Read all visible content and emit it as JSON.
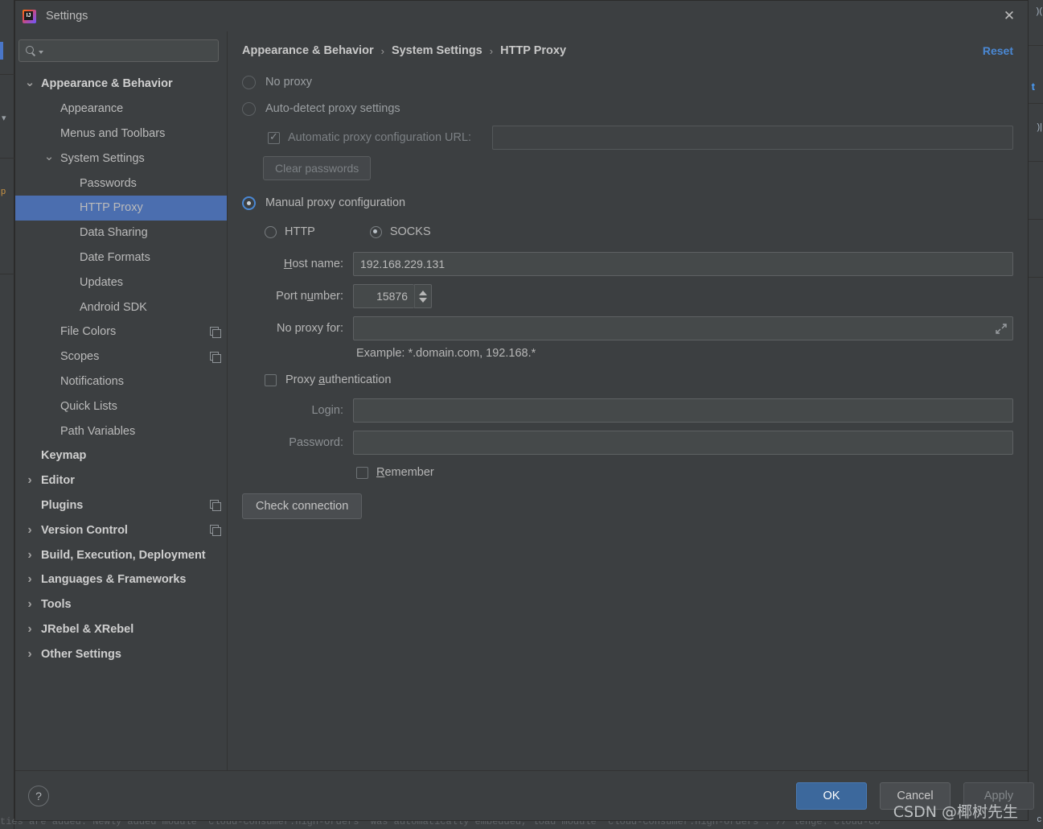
{
  "window": {
    "title": "Settings",
    "logo_icon": "intellij-idea-logo",
    "close_icon": "close-icon"
  },
  "sidebar": {
    "search": {
      "placeholder": "",
      "value": "",
      "icon": "search-icon",
      "caret_icon": "chevron-down-icon"
    },
    "items": [
      {
        "label": "Appearance & Behavior",
        "indent": 0,
        "arrow": "expanded",
        "bold": true,
        "selected": false,
        "copy_icon": false
      },
      {
        "label": "Appearance",
        "indent": 1,
        "arrow": "none",
        "bold": false,
        "selected": false,
        "copy_icon": false
      },
      {
        "label": "Menus and Toolbars",
        "indent": 1,
        "arrow": "none",
        "bold": false,
        "selected": false,
        "copy_icon": false
      },
      {
        "label": "System Settings",
        "indent": 1,
        "arrow": "expanded",
        "bold": false,
        "selected": false,
        "copy_icon": false
      },
      {
        "label": "Passwords",
        "indent": 2,
        "arrow": "none",
        "bold": false,
        "selected": false,
        "copy_icon": false
      },
      {
        "label": "HTTP Proxy",
        "indent": 2,
        "arrow": "none",
        "bold": false,
        "selected": true,
        "copy_icon": false
      },
      {
        "label": "Data Sharing",
        "indent": 2,
        "arrow": "none",
        "bold": false,
        "selected": false,
        "copy_icon": false
      },
      {
        "label": "Date Formats",
        "indent": 2,
        "arrow": "none",
        "bold": false,
        "selected": false,
        "copy_icon": false
      },
      {
        "label": "Updates",
        "indent": 2,
        "arrow": "none",
        "bold": false,
        "selected": false,
        "copy_icon": false
      },
      {
        "label": "Android SDK",
        "indent": 2,
        "arrow": "none",
        "bold": false,
        "selected": false,
        "copy_icon": false
      },
      {
        "label": "File Colors",
        "indent": 1,
        "arrow": "none",
        "bold": false,
        "selected": false,
        "copy_icon": true
      },
      {
        "label": "Scopes",
        "indent": 1,
        "arrow": "none",
        "bold": false,
        "selected": false,
        "copy_icon": true
      },
      {
        "label": "Notifications",
        "indent": 1,
        "arrow": "none",
        "bold": false,
        "selected": false,
        "copy_icon": false
      },
      {
        "label": "Quick Lists",
        "indent": 1,
        "arrow": "none",
        "bold": false,
        "selected": false,
        "copy_icon": false
      },
      {
        "label": "Path Variables",
        "indent": 1,
        "arrow": "none",
        "bold": false,
        "selected": false,
        "copy_icon": false
      },
      {
        "label": "Keymap",
        "indent": 0,
        "arrow": "none",
        "bold": true,
        "selected": false,
        "copy_icon": false
      },
      {
        "label": "Editor",
        "indent": 0,
        "arrow": "collapsed",
        "bold": true,
        "selected": false,
        "copy_icon": false
      },
      {
        "label": "Plugins",
        "indent": 0,
        "arrow": "none",
        "bold": true,
        "selected": false,
        "copy_icon": true
      },
      {
        "label": "Version Control",
        "indent": 0,
        "arrow": "collapsed",
        "bold": true,
        "selected": false,
        "copy_icon": true
      },
      {
        "label": "Build, Execution, Deployment",
        "indent": 0,
        "arrow": "collapsed",
        "bold": true,
        "selected": false,
        "copy_icon": false
      },
      {
        "label": "Languages & Frameworks",
        "indent": 0,
        "arrow": "collapsed",
        "bold": true,
        "selected": false,
        "copy_icon": false
      },
      {
        "label": "Tools",
        "indent": 0,
        "arrow": "collapsed",
        "bold": true,
        "selected": false,
        "copy_icon": false
      },
      {
        "label": "JRebel & XRebel",
        "indent": 0,
        "arrow": "collapsed",
        "bold": true,
        "selected": false,
        "copy_icon": false
      },
      {
        "label": "Other Settings",
        "indent": 0,
        "arrow": "collapsed",
        "bold": true,
        "selected": false,
        "copy_icon": false
      }
    ]
  },
  "main": {
    "breadcrumb": {
      "part1": "Appearance & Behavior",
      "sep1": "›",
      "part2": "System Settings",
      "sep2": "›",
      "part3": "HTTP Proxy"
    },
    "reset_label": "Reset",
    "no_proxy": {
      "label": "No proxy",
      "checked": false
    },
    "auto_detect": {
      "label": "Auto-detect proxy settings",
      "checked": false
    },
    "pac": {
      "label": "Automatic proxy configuration URL:",
      "checked": true,
      "value": "",
      "disabled": true
    },
    "clear_passwords_label": "Clear passwords",
    "manual": {
      "label": "Manual proxy configuration",
      "checked": true
    },
    "protocol": {
      "http_label": "HTTP",
      "http_checked": false,
      "socks_label": "SOCKS",
      "socks_checked": true
    },
    "host": {
      "label": "Host name:",
      "value": "192.168.229.131"
    },
    "port": {
      "label": "Port number:",
      "value": "15876"
    },
    "no_proxy_for": {
      "label": "No proxy for:",
      "value": "",
      "expand_icon": "expand-icon"
    },
    "example_text": "Example: *.domain.com, 192.168.*",
    "proxy_auth": {
      "label": "Proxy authentication",
      "checked": false
    },
    "login": {
      "label": "Login:",
      "value": ""
    },
    "password": {
      "label": "Password:",
      "value": ""
    },
    "remember": {
      "label": "Remember",
      "checked": false
    },
    "check_connection_label": "Check connection"
  },
  "footer": {
    "help_label": "?",
    "ok_label": "OK",
    "cancel_label": "Cancel",
    "apply_label": "Apply"
  },
  "watermark": "CSDN @椰树先生",
  "background": {
    "left_glyph_1": "▾",
    "left_glyph_2": "p",
    "right_glyph_1": ")(",
    "right_glyph_2": ")|",
    "right_text": "t",
    "bottom_text": "ties are added. Newly added module 'cloud-consumer.high-orders' was automatically embedded, load module 'cloud-consumer.high-orders'. //  lenge: cloud-co",
    "bottom_right_glyph": "c"
  },
  "colors": {
    "selection": "#4b6eaf",
    "accent_link": "#4a88d4",
    "ok_button": "#3c689c",
    "panel": "#3c3f41",
    "field": "#45494a"
  }
}
